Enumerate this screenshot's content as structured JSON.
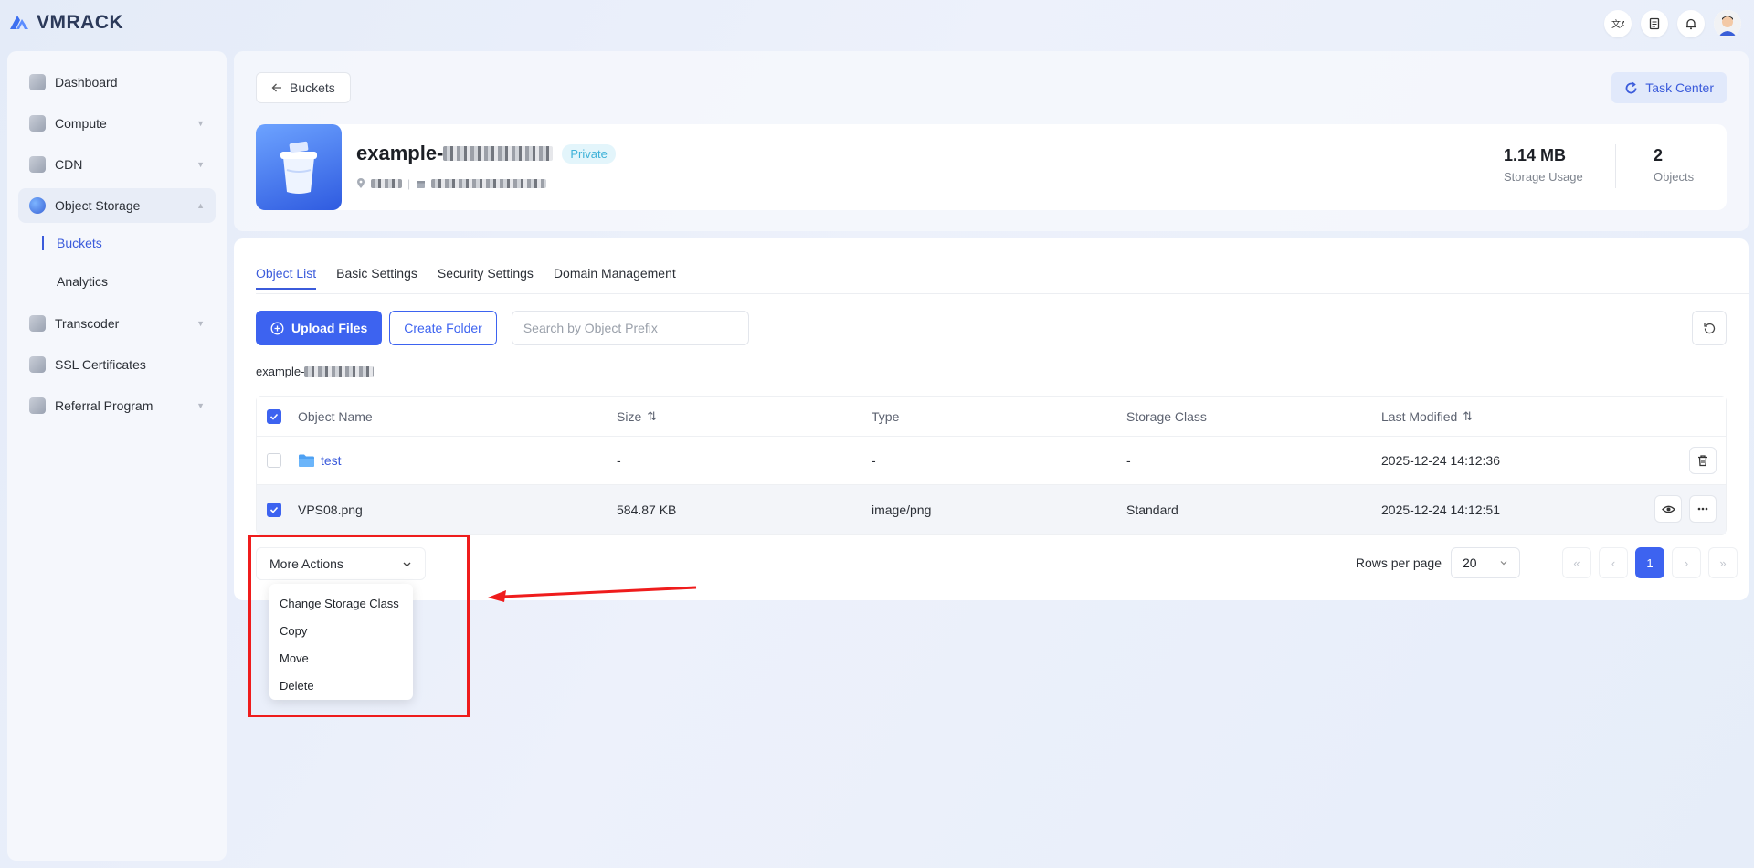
{
  "app": {
    "brand": "VMRACK"
  },
  "sidebar": {
    "items": [
      {
        "label": "Dashboard"
      },
      {
        "label": "Compute"
      },
      {
        "label": "CDN"
      },
      {
        "label": "Object Storage"
      },
      {
        "label": "Buckets"
      },
      {
        "label": "Analytics"
      },
      {
        "label": "Transcoder"
      },
      {
        "label": "SSL Certificates"
      },
      {
        "label": "Referral Program"
      }
    ]
  },
  "header": {
    "back_label": "Buckets",
    "task_center_label": "Task Center",
    "bucket_name_prefix": "example-",
    "visibility_badge": "Private",
    "storage_usage_value": "1.14 MB",
    "storage_usage_label": "Storage Usage",
    "objects_value": "2",
    "objects_label": "Objects"
  },
  "tabs": [
    {
      "label": "Object List"
    },
    {
      "label": "Basic Settings"
    },
    {
      "label": "Security Settings"
    },
    {
      "label": "Domain Management"
    }
  ],
  "toolbar": {
    "upload_label": "Upload Files",
    "create_folder_label": "Create Folder",
    "search_placeholder": "Search by Object Prefix"
  },
  "path": {
    "prefix": "example-"
  },
  "table": {
    "columns": [
      "Object Name",
      "Size",
      "Type",
      "Storage Class",
      "Last Modified"
    ],
    "rows": [
      {
        "name": "test",
        "size": "-",
        "type": "-",
        "storage_class": "-",
        "modified": "2025-12-24 14:12:36"
      },
      {
        "name": "VPS08.png",
        "size": "584.87 KB",
        "type": "image/png",
        "storage_class": "Standard",
        "modified": "2025-12-24 14:12:51"
      }
    ]
  },
  "more_actions": {
    "label": "More Actions",
    "options": [
      "Change Storage Class",
      "Copy",
      "Move",
      "Delete"
    ]
  },
  "pagination": {
    "rows_per_page_label": "Rows per page",
    "rows_per_page_value": "20",
    "current_page": "1"
  },
  "colors": {
    "accent": "#3d63f0",
    "annotation": "#ef1c1c"
  }
}
